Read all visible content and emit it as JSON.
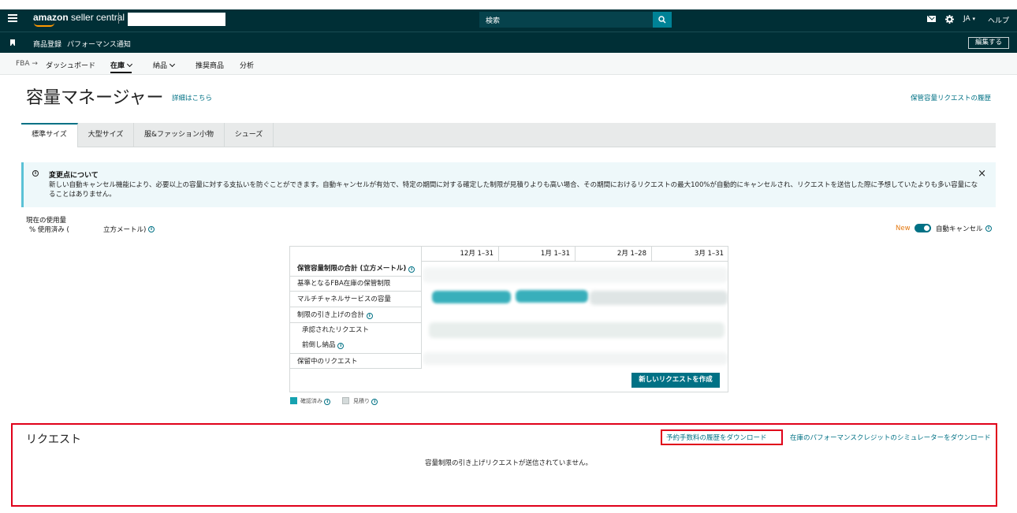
{
  "topbar": {
    "logo_brand": "amazon",
    "logo_product": "seller central",
    "search_placeholder": "検索",
    "language": "JA",
    "help": "ヘルプ"
  },
  "bookmarks": {
    "items": [
      "商品登録",
      "パフォーマンス通知"
    ],
    "edit_label": "編集する"
  },
  "nav": {
    "crumb": "FBA",
    "arrow": "→",
    "items": [
      {
        "label": "ダッシュボード"
      },
      {
        "label": "在庫",
        "active": true,
        "dropdown": true
      },
      {
        "label": "納品",
        "dropdown": true
      },
      {
        "label": "推奨商品"
      },
      {
        "label": "分析"
      }
    ]
  },
  "page": {
    "title": "容量マネージャー",
    "details_link": "詳細はこちら",
    "history_link": "保管容量リクエストの履歴"
  },
  "tabs": [
    {
      "label": "標準サイズ",
      "active": true
    },
    {
      "label": "大型サイズ"
    },
    {
      "label": "服&ファッション小物"
    },
    {
      "label": "シューズ"
    }
  ],
  "alert": {
    "title": "変更点について",
    "body": "新しい自動キャンセル機能により、必要以上の容量に対する支払いを防ぐことができます。自動キャンセルが有効で、特定の期間に対する確定した制限が見積りよりも高い場合、その期間におけるリクエストの最大100%が自動的にキャンセルされ、リクエストを送信した際に予想していたよりも多い容量になることはありません。",
    "close": "×"
  },
  "usage": {
    "label": "現在の使用量",
    "percent": "% 使用済み (",
    "unit": "立方メートル)"
  },
  "auto_cancel": {
    "new_badge": "New",
    "label": "自動キャンセル",
    "enabled": true
  },
  "capacity_table": {
    "columns": [
      "12月 1–31",
      "1月 1–31",
      "2月 1–28",
      "3月 1–31"
    ],
    "rows": [
      {
        "label": "保管容量制限の合計 (立方メートル)",
        "info": true,
        "bold": true
      },
      {
        "label": "基準となるFBA在庫の保管制限"
      },
      {
        "label": "マルチチャネルサービスの容量"
      },
      {
        "label": "制限の引き上げの合計",
        "info": true
      },
      {
        "label": "承認されたリクエスト",
        "sub": true
      },
      {
        "label": "前倒し納品",
        "info": true,
        "sub": true
      },
      {
        "label": "保留中のリクエスト"
      }
    ],
    "new_request_button": "新しいリクエストを作成",
    "legend": [
      {
        "label": "確認済み",
        "color": "#16a2b0"
      },
      {
        "label": "見積り",
        "color": "#d5dbdb"
      }
    ]
  },
  "requests": {
    "title": "リクエスト",
    "download_fee_history": "予約手数料の履歴をダウンロード",
    "download_simulator": "在庫のパフォーマンスクレジットのシミュレーターをダウンロード",
    "empty_message": "容量制限の引き上げリクエストが送信されていません。"
  },
  "colors": {
    "header_bg": "#002f36",
    "accent": "#007185",
    "highlight": "#e0001a"
  }
}
